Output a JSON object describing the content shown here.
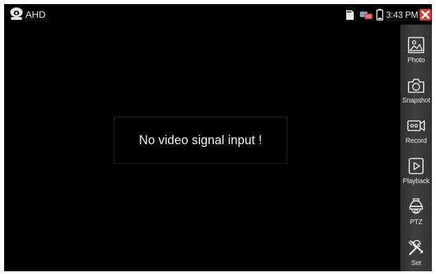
{
  "status_bar": {
    "app_name": "AHD",
    "app_icon": "camera-head-icon",
    "sd_icon": "sd-card-icon",
    "network_icon": "network-icon",
    "battery_icon": "battery-icon",
    "time": "3:43 PM",
    "close_icon": "close-icon"
  },
  "video": {
    "message": "No video signal input  !"
  },
  "toolbar": {
    "items": [
      {
        "label": "Photo",
        "icon": "photo-icon"
      },
      {
        "label": "Snapshot",
        "icon": "camera-icon"
      },
      {
        "label": "Record",
        "icon": "video-record-icon"
      },
      {
        "label": "Playback",
        "icon": "play-icon"
      },
      {
        "label": "PTZ",
        "icon": "ptz-camera-icon"
      },
      {
        "label": "Set",
        "icon": "tools-icon"
      }
    ]
  },
  "colors": {
    "background": "#000000",
    "text": "#e8e8e8",
    "close_button": "#e03a2e",
    "sidebar": "#3a3a3a",
    "network_icon": "#d94a4a"
  }
}
